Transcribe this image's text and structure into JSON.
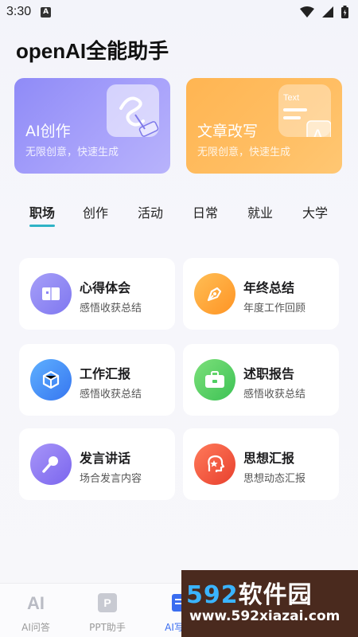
{
  "status_bar": {
    "time": "3:30",
    "badge": "A"
  },
  "app": {
    "title": "openAI全能助手"
  },
  "hero_cards": [
    {
      "title": "AI创作",
      "subtitle": "无限创意，快速生成",
      "icon": "pen-scribble-icon"
    },
    {
      "title": "文章改写",
      "subtitle": "无限创意，快速生成",
      "icon": "text-document-icon",
      "deco_text": "Text",
      "deco_letter": "A"
    }
  ],
  "tabs": [
    {
      "label": "职场",
      "active": true
    },
    {
      "label": "创作",
      "active": false
    },
    {
      "label": "活动",
      "active": false
    },
    {
      "label": "日常",
      "active": false
    },
    {
      "label": "就业",
      "active": false
    },
    {
      "label": "大学",
      "active": false
    }
  ],
  "cards": [
    {
      "title": "心得体会",
      "subtitle": "感悟收获总结",
      "icon": "book-icon",
      "color": "#8b84f5"
    },
    {
      "title": "年终总结",
      "subtitle": "年度工作回顾",
      "icon": "pen-nib-icon",
      "color": "#ffa12f"
    },
    {
      "title": "工作汇报",
      "subtitle": "感悟收获总结",
      "icon": "cube-icon",
      "color": "#3f8df5"
    },
    {
      "title": "述职报告",
      "subtitle": "感悟收获总结",
      "icon": "briefcase-icon",
      "color": "#4fcf62"
    },
    {
      "title": "发言讲话",
      "subtitle": "场合发言内容",
      "icon": "microphone-icon",
      "color": "#8f7bf2"
    },
    {
      "title": "思想汇报",
      "subtitle": "思想动态汇报",
      "icon": "star-head-icon",
      "color": "#f0513a"
    }
  ],
  "bottom_nav": [
    {
      "label": "AI问答",
      "icon": "ai-icon",
      "icon_text": "AI",
      "active": false
    },
    {
      "label": "PPT助手",
      "icon": "ppt-icon",
      "icon_text": "P",
      "active": false
    },
    {
      "label": "AI写作",
      "icon": "writing-icon",
      "active": true
    }
  ],
  "watermark": {
    "num": "592",
    "cn": "软件园",
    "url": "www.592xiazai.com"
  }
}
